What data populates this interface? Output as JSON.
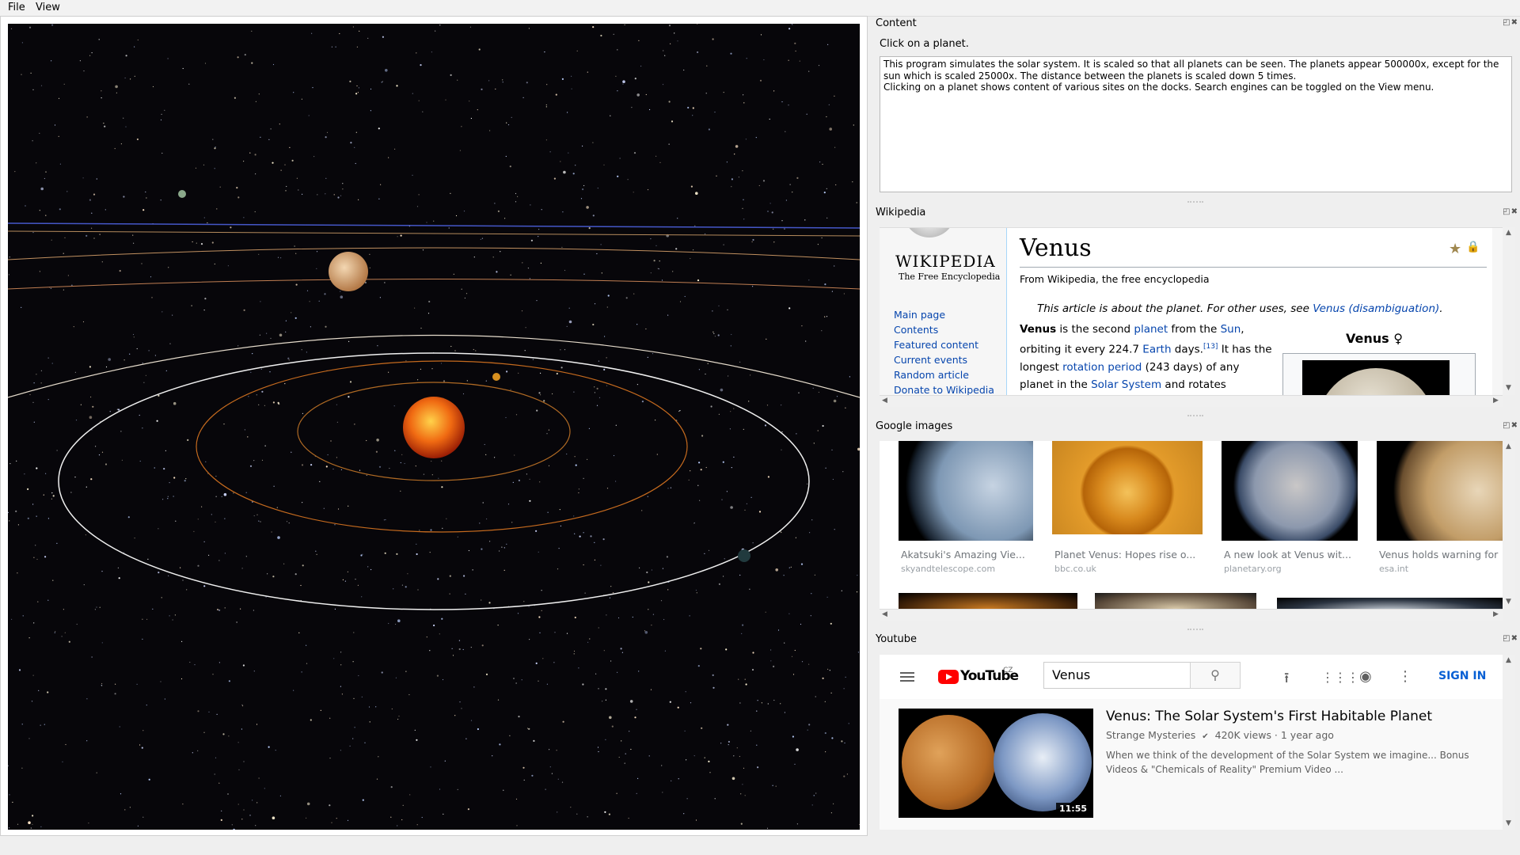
{
  "menu": {
    "file": "File",
    "view": "View"
  },
  "docks": {
    "content_title": "Content",
    "wikipedia_title": "Wikipedia",
    "google_title": "Google images",
    "youtube_title": "Youtube",
    "dock_buttons": "◰✖"
  },
  "content": {
    "hint": "Click on a planet.",
    "description": "This program simulates the solar system. It is scaled so that all planets can be seen. The planets appear 500000x, except for the sun which is scaled 25000x. The distance between the planets is scaled down 5 times.\nClicking on a planet shows content of various sites on the docks. Search engines can be toggled on the View menu."
  },
  "wikipedia": {
    "logo_word": "WIKIPEDIA",
    "logo_sub": "The Free Encyclopedia",
    "nav": [
      "Main page",
      "Contents",
      "Featured content",
      "Current events",
      "Random article",
      "Donate to Wikipedia"
    ],
    "title": "Venus",
    "from": "From Wikipedia, the free encyclopedia",
    "hatnote_prefix": "This article is about the planet. For other uses, see ",
    "hatnote_link": "Venus (disambiguation)",
    "hatnote_suffix": ".",
    "body": {
      "b1": "Venus",
      "t1": " is the second ",
      "l1": "planet",
      "t2": " from the ",
      "l2": "Sun",
      "t3": ", orbiting it every 224.7 ",
      "l3": "Earth",
      "t4": " days.",
      "ref": "[13]",
      "t5": " It has the longest ",
      "l4": "rotation period",
      "t6": " (243 days) of any planet in the ",
      "l5": "Solar System",
      "t7": " and rotates"
    },
    "infobox_title": "Venus ♀"
  },
  "google_images": {
    "results": [
      {
        "caption": "Akatsuki's Amazing Vie...",
        "site": "skyandtelescope.com",
        "color": "#9fb3c7"
      },
      {
        "caption": "Planet Venus: Hopes rise o...",
        "site": "bbc.co.uk",
        "color": "#d88a1d"
      },
      {
        "caption": "A new look at Venus wit...",
        "site": "planetary.org",
        "color": "#a7adba"
      },
      {
        "caption": "Venus holds warning for",
        "site": "esa.int",
        "color": "#c8a878"
      }
    ]
  },
  "youtube": {
    "logo": "YouTube",
    "region": "CZ",
    "search_value": "Venus",
    "sign_in": "SIGN IN",
    "video": {
      "title": "Venus: The Solar System's First Habitable Planet",
      "channel": "Strange Mysteries",
      "verified": "✔",
      "views": "420K views",
      "age": "1 year ago",
      "duration": "11:55",
      "description": "When we think of the development of the Solar System we imagine... Bonus Videos & \"Chemicals of Reality\" Premium Video ..."
    }
  }
}
